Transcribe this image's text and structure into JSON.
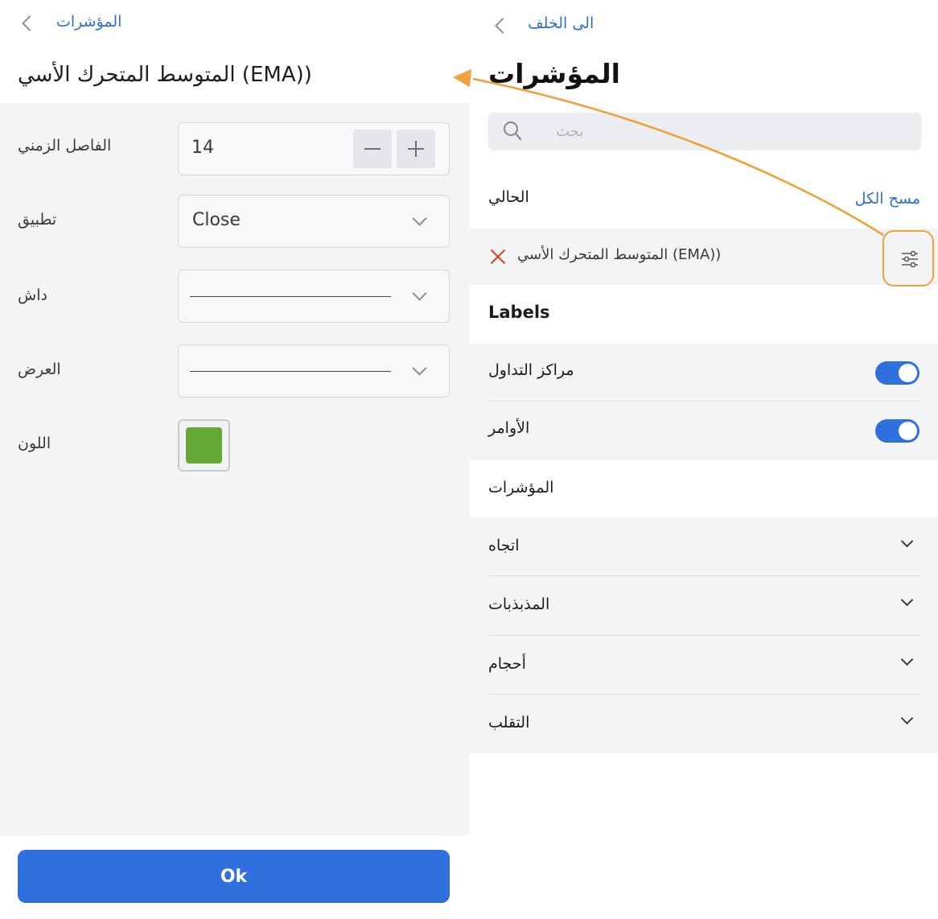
{
  "left_panel": {
    "back_label": "المؤشرات",
    "title": "المتوسط المتحرك الأسي (EMA))",
    "form": {
      "period_label": "الفاصل الزمني",
      "period_value": "14",
      "apply_label": "تطبيق",
      "apply_value": "Close",
      "dash_label": "داش",
      "width_label": "العرض",
      "color_label": "اللون",
      "color_value": "#65a835"
    },
    "ok_label": "Ok"
  },
  "right_panel": {
    "back_label": "الى الخلف",
    "title": "المؤشرات",
    "search_placeholder": "بحث",
    "current_label": "الحالي",
    "clear_all_label": "مسح الكل",
    "active_indicator": "المتوسط المتحرك الأسي (EMA))",
    "labels_heading": "Labels",
    "toggles": [
      {
        "label": "مراكز التداول",
        "on": true
      },
      {
        "label": "الأوامر",
        "on": true
      }
    ],
    "indicators_heading": "المؤشرات",
    "categories": [
      {
        "label": "اتجاه"
      },
      {
        "label": "المذبذبات"
      },
      {
        "label": "أحجام"
      },
      {
        "label": "التقلب"
      }
    ]
  },
  "colors": {
    "accent_blue": "#2f6fde",
    "toggle_on": "#2f6fde",
    "annotation_orange": "#f0a23a",
    "remove_red": "#d9422b"
  },
  "icons": [
    "chevron-left-icon",
    "search-icon",
    "close-icon",
    "settings-sliders-icon",
    "chevron-down-icon",
    "minus-icon",
    "plus-icon"
  ]
}
